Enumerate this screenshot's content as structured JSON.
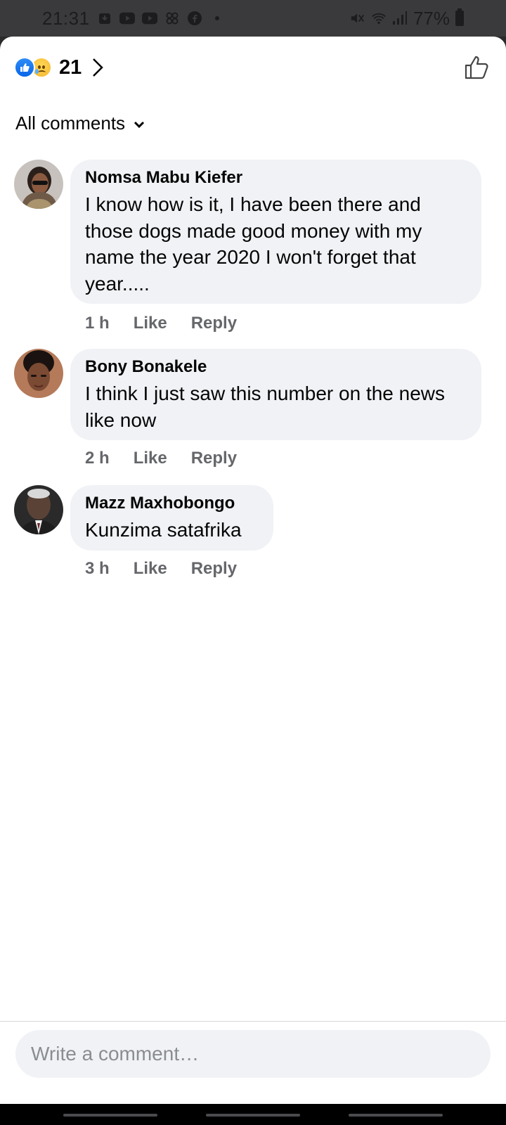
{
  "status_bar": {
    "time": "21:31",
    "battery": "77%"
  },
  "reactions": {
    "count": "21"
  },
  "sort": {
    "label": "All comments"
  },
  "comments": [
    {
      "author": "Nomsa Mabu Kiefer",
      "text": "I know how is it, I have been there and those dogs made good money with my name the year 2020 I won't forget that year.....",
      "time": "1 h",
      "like": "Like",
      "reply": "Reply"
    },
    {
      "author": "Bony Bonakele",
      "text": "I think I just saw this number on the news like now",
      "time": "2 h",
      "like": "Like",
      "reply": "Reply"
    },
    {
      "author": "Mazz Maxhobongo",
      "text": "Kunzima satafrika",
      "time": "3 h",
      "like": "Like",
      "reply": "Reply"
    }
  ],
  "composer": {
    "placeholder": "Write a comment…"
  }
}
